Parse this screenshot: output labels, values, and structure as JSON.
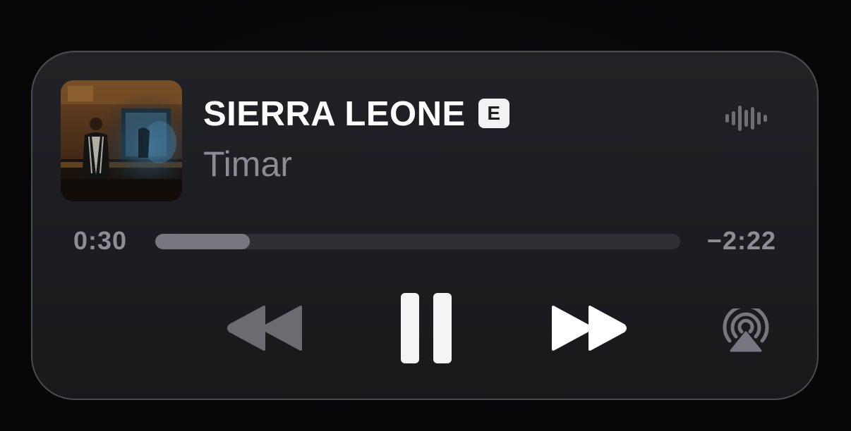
{
  "now_playing": {
    "title": "SIERRA LEONE",
    "explicit_label": "E",
    "artist": "Timar",
    "artwork_alt": "Album artwork"
  },
  "progress": {
    "elapsed": "0:30",
    "remaining": "−2:22",
    "fraction": 0.18
  },
  "controls": {
    "rewind_icon": "rewind-icon",
    "pause_icon": "pause-icon",
    "forward_icon": "fast-forward-icon",
    "airplay_icon": "airplay-icon",
    "waveform_icon": "waveform-icon"
  },
  "colors": {
    "background": "#070708",
    "card": "#1e1f22",
    "title": "#ffffff",
    "artist": "#8c8c94",
    "time": "#8d8d95",
    "track": "#2f3036",
    "fill": "#77777f",
    "rewind": "#6b6b72",
    "pause": "#f4f4f6",
    "forward": "#ffffff",
    "airplay": "#77777f"
  }
}
